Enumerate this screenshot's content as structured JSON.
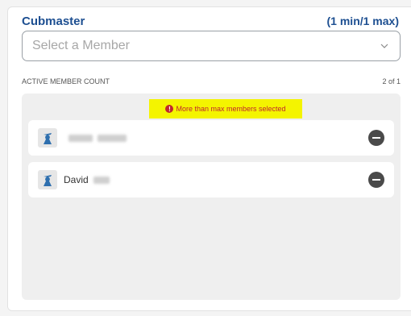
{
  "role": {
    "title": "Cubmaster",
    "limit": "(1 min/1 max)"
  },
  "select": {
    "placeholder": "Select a Member",
    "icon": "chevron-down-icon"
  },
  "count": {
    "label": "ACTIVE MEMBER COUNT",
    "value": "2 of 1"
  },
  "error": {
    "message": "More than max members selected",
    "icon": "error-icon"
  },
  "members": [
    {
      "name": "",
      "avatar_icon": "scout-profile-icon"
    },
    {
      "name": "David",
      "avatar_icon": "scout-profile-icon"
    }
  ],
  "colors": {
    "title": "#1d4f91",
    "error_text": "#c0262d",
    "error_highlight": "#f4f400",
    "panel_bg": "#efefef"
  }
}
